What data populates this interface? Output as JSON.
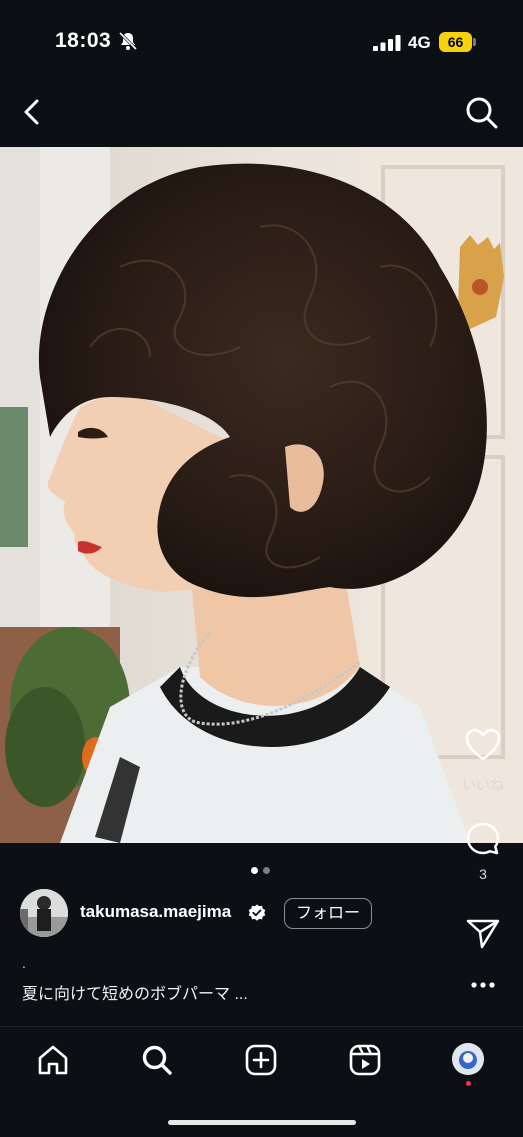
{
  "status_bar": {
    "time": "18:03",
    "network": "4G",
    "battery": "66"
  },
  "post": {
    "author": "takumasa.maejima",
    "follow_label": "フォロー",
    "caption_dot": ".",
    "caption": "夏に向けて短めのボブパーマ ...",
    "like_label": "いいね",
    "comment_count": "3",
    "carousel": {
      "count": 2,
      "active": 1
    }
  },
  "icons": {
    "back": "chevron-left-icon",
    "search": "search-icon",
    "like": "heart-icon",
    "comment": "comment-icon",
    "share": "send-icon",
    "more": "more-icon"
  },
  "bottom_nav": [
    "home",
    "search",
    "create",
    "reels",
    "profile"
  ],
  "colors": {
    "background": "#0c1014",
    "battery": "#f7d20c",
    "notification_dot": "#ff3040"
  }
}
